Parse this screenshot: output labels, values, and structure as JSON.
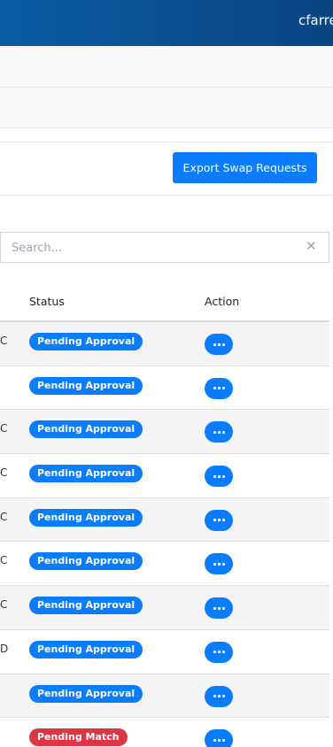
{
  "header": {
    "username": "cfarre"
  },
  "toolbar": {
    "export_label": "Export Swap Requests"
  },
  "search": {
    "placeholder": "Search...",
    "clear_icon": "close-icon"
  },
  "table": {
    "columns": [
      "Status",
      "Action"
    ],
    "rows": [
      {
        "prefix": "C",
        "status": "Pending Approval",
        "status_color": "#0a7cff"
      },
      {
        "prefix": "",
        "status": "Pending Approval",
        "status_color": "#0a7cff"
      },
      {
        "prefix": "C",
        "status": "Pending Approval",
        "status_color": "#0a7cff"
      },
      {
        "prefix": "C",
        "status": "Pending Approval",
        "status_color": "#0a7cff"
      },
      {
        "prefix": "C",
        "status": "Pending Approval",
        "status_color": "#0a7cff"
      },
      {
        "prefix": "C",
        "status": "Pending Approval",
        "status_color": "#0a7cff"
      },
      {
        "prefix": "C",
        "status": "Pending Approval",
        "status_color": "#0a7cff"
      },
      {
        "prefix": "D",
        "status": "Pending Approval",
        "status_color": "#0a7cff"
      },
      {
        "prefix": "",
        "status": "Pending Approval",
        "status_color": "#0a7cff"
      },
      {
        "prefix": "",
        "status": "Pending Match",
        "status_color": "#dc3545"
      }
    ]
  },
  "colors": {
    "header_bg": "#0a4e8e",
    "accent": "#0a7cff",
    "danger": "#dc3545"
  }
}
